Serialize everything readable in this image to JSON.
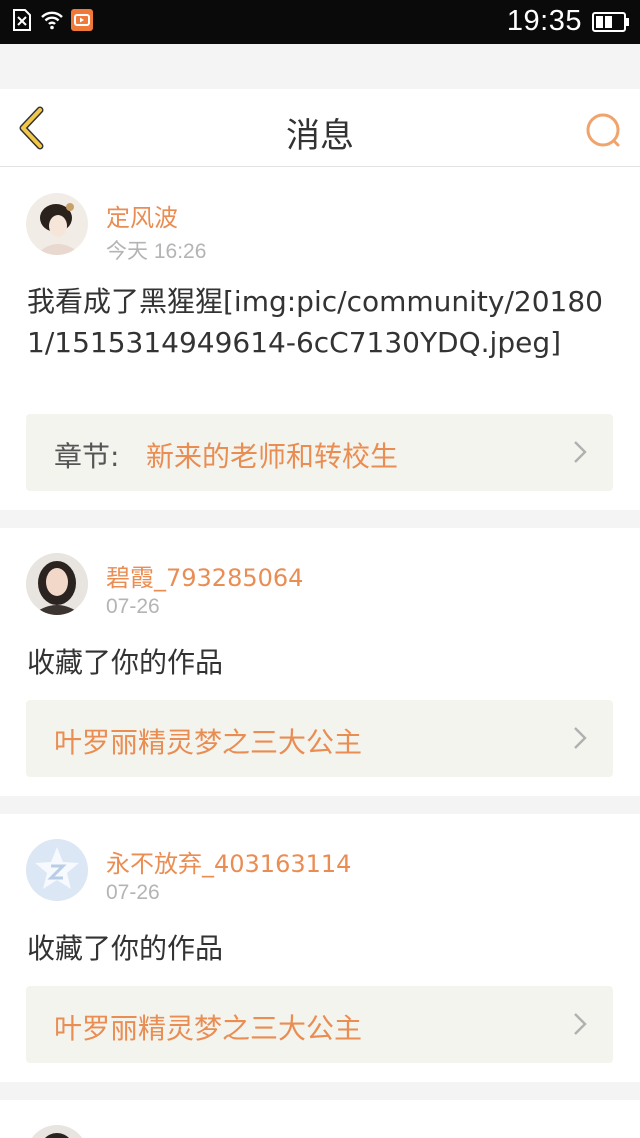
{
  "status_bar": {
    "time": "19:35",
    "icons": [
      "sim-off-icon",
      "wifi-icon",
      "app-notification-icon",
      "battery-icon"
    ]
  },
  "header": {
    "title": "消息",
    "back_icon": "chevron-left-icon",
    "search_icon": "search-icon"
  },
  "colors": {
    "accent": "#ea8d53",
    "back_icon": "#f2c84b",
    "text": "#333333",
    "muted": "#b4b4b4",
    "card_link_bg": "#f4f4ee",
    "page_bg": "#f4f4f4"
  },
  "messages": [
    {
      "user": "定风波",
      "time": "今天 16:26",
      "content": "我看成了黑猩猩[img:pic/community/201801/1515314949614-6cC7130YDQ.jpeg]",
      "link_prefix": "章节:",
      "link_text": "新来的老师和转校生"
    },
    {
      "user": "碧霞_793285064",
      "time": "07-26",
      "content": "收藏了你的作品",
      "link_text": "叶罗丽精灵梦之三大公主"
    },
    {
      "user": "永不放弃_403163114",
      "time": "07-26",
      "content": "收藏了你的作品",
      "link_text": "叶罗丽精灵梦之三大公主"
    }
  ]
}
